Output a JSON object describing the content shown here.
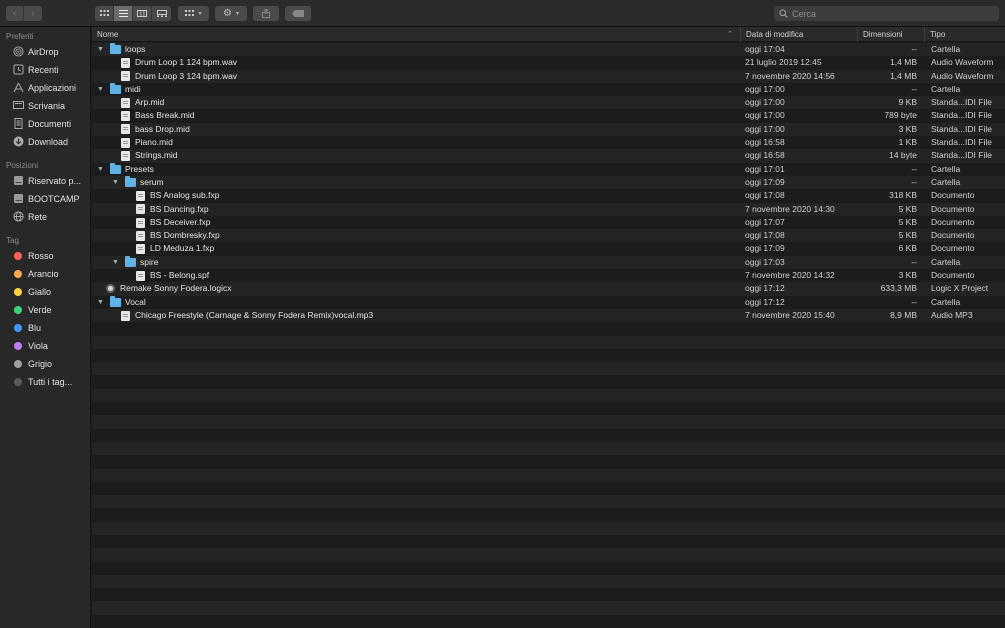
{
  "search": {
    "placeholder": "Cerca"
  },
  "sidebar": {
    "favorites_heading": "Preferiti",
    "favorites": [
      {
        "label": "AirDrop",
        "icon": "airdrop-icon"
      },
      {
        "label": "Recenti",
        "icon": "clock-icon"
      },
      {
        "label": "Applicazioni",
        "icon": "applications-icon"
      },
      {
        "label": "Scrivania",
        "icon": "desktop-icon"
      },
      {
        "label": "Documenti",
        "icon": "document-icon"
      },
      {
        "label": "Download",
        "icon": "download-icon"
      }
    ],
    "locations_heading": "Posizioni",
    "locations": [
      {
        "label": "Riservato p...",
        "icon": "disk-icon"
      },
      {
        "label": "BOOTCAMP",
        "icon": "disk-icon"
      },
      {
        "label": "Rete",
        "icon": "network-icon"
      }
    ],
    "tags_heading": "Tag",
    "tags": [
      {
        "label": "Rosso",
        "color": "#ff5f57"
      },
      {
        "label": "Arancio",
        "color": "#ffa94d"
      },
      {
        "label": "Giallo",
        "color": "#f5d43f"
      },
      {
        "label": "Verde",
        "color": "#3ed27a"
      },
      {
        "label": "Blu",
        "color": "#3e9bff"
      },
      {
        "label": "Viola",
        "color": "#c17cf0"
      },
      {
        "label": "Grigio",
        "color": "#a0a0a0"
      },
      {
        "label": "Tutti i tag...",
        "color": "#5a5a5a"
      }
    ]
  },
  "columns": {
    "name": "Nome",
    "date": "Data di modifica",
    "size": "Dimensioni",
    "type": "Tipo"
  },
  "files": [
    {
      "name": "loops",
      "kind": "folder",
      "depth": 0,
      "expanded": true,
      "date": "oggi 17:04",
      "size": "--",
      "type": "Cartella"
    },
    {
      "name": "Drum Loop 1 124 bpm.wav",
      "kind": "file",
      "depth": 1,
      "date": "21 luglio 2019 12:45",
      "size": "1,4 MB",
      "type": "Audio Waveform"
    },
    {
      "name": "Drum Loop 3 124 bpm.wav",
      "kind": "file",
      "depth": 1,
      "date": "7 novembre 2020 14:56",
      "size": "1,4 MB",
      "type": "Audio Waveform"
    },
    {
      "name": "midi",
      "kind": "folder",
      "depth": 0,
      "expanded": true,
      "date": "oggi 17:00",
      "size": "--",
      "type": "Cartella"
    },
    {
      "name": "Arp.mid",
      "kind": "file",
      "depth": 1,
      "date": "oggi 17:00",
      "size": "9 KB",
      "type": "Standa...IDI File"
    },
    {
      "name": "Bass Break.mid",
      "kind": "file",
      "depth": 1,
      "date": "oggi 17:00",
      "size": "789 byte",
      "type": "Standa...IDI File"
    },
    {
      "name": "bass Drop.mid",
      "kind": "file",
      "depth": 1,
      "date": "oggi 17:00",
      "size": "3 KB",
      "type": "Standa...IDI File"
    },
    {
      "name": "Piano.mid",
      "kind": "file",
      "depth": 1,
      "date": "oggi 16:58",
      "size": "1 KB",
      "type": "Standa...IDI File"
    },
    {
      "name": "Strings.mid",
      "kind": "file",
      "depth": 1,
      "date": "oggi 16:58",
      "size": "14 byte",
      "type": "Standa...IDI File"
    },
    {
      "name": "Presets",
      "kind": "folder",
      "depth": 0,
      "expanded": true,
      "date": "oggi 17:01",
      "size": "--",
      "type": "Cartella"
    },
    {
      "name": "serum",
      "kind": "folder",
      "depth": 1,
      "expanded": true,
      "date": "oggi 17:09",
      "size": "--",
      "type": "Cartella"
    },
    {
      "name": "BS Analog sub.fxp",
      "kind": "file",
      "depth": 2,
      "date": "oggi 17:08",
      "size": "318 KB",
      "type": "Documento"
    },
    {
      "name": "BS Dancing.fxp",
      "kind": "file",
      "depth": 2,
      "date": "7 novembre 2020 14:30",
      "size": "5 KB",
      "type": "Documento"
    },
    {
      "name": "BS Deceiver.fxp",
      "kind": "file",
      "depth": 2,
      "date": "oggi 17:07",
      "size": "5 KB",
      "type": "Documento"
    },
    {
      "name": "BS Dombresky.fxp",
      "kind": "file",
      "depth": 2,
      "date": "oggi 17:08",
      "size": "5 KB",
      "type": "Documento"
    },
    {
      "name": "LD Meduza 1.fxp",
      "kind": "file",
      "depth": 2,
      "date": "oggi 17:09",
      "size": "6 KB",
      "type": "Documento"
    },
    {
      "name": "spire",
      "kind": "folder",
      "depth": 1,
      "expanded": true,
      "date": "oggi 17:03",
      "size": "--",
      "type": "Cartella"
    },
    {
      "name": "BS - Belong.spf",
      "kind": "file",
      "depth": 2,
      "date": "7 novembre 2020 14:32",
      "size": "3 KB",
      "type": "Documento"
    },
    {
      "name": "Remake Sonny Fodera.logicx",
      "kind": "project",
      "depth": 0,
      "date": "oggi 17:12",
      "size": "633,3 MB",
      "type": "Logic X Project"
    },
    {
      "name": "Vocal",
      "kind": "folder",
      "depth": 0,
      "expanded": true,
      "date": "oggi 17:12",
      "size": "--",
      "type": "Cartella"
    },
    {
      "name": "Chicago Freestyle (Carnage & Sonny Fodera Remix)vocal.mp3",
      "kind": "file",
      "depth": 1,
      "date": "7 novembre 2020 15:40",
      "size": "8,9 MB",
      "type": "Audio MP3"
    }
  ]
}
